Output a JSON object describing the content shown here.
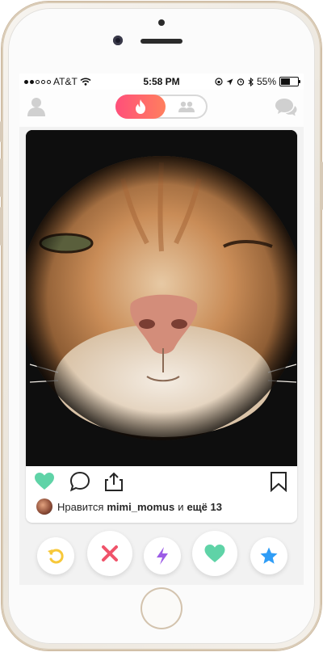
{
  "status_bar": {
    "carrier": "AT&T",
    "time": "5:58 PM",
    "battery_percent": "55%",
    "battery_level": 0.55,
    "signal_dots_filled": 2
  },
  "top_bar": {
    "left_icon": "profile-icon",
    "toggle": {
      "active": "flame-icon",
      "inactive": "group-icon"
    },
    "right_icon": "chat-icon"
  },
  "card": {
    "photo_subject": "",
    "actions": [
      "heart-icon",
      "comment-icon",
      "share-icon",
      "bookmark-icon"
    ],
    "liked_by": {
      "prefix": "Нравится",
      "user": "mimi_momus",
      "conj": "и",
      "others": "ещё 13"
    }
  },
  "bottom_actions": [
    "rewind-icon",
    "nope-icon",
    "boost-icon",
    "like-icon",
    "super-like-icon"
  ],
  "colors": {
    "accent_gradient_start": "#ff4f7a",
    "accent_gradient_end": "#ff7f5e",
    "like_green": "#5fd3a7",
    "nope_red": "#f0536a",
    "rewind_yellow": "#f7c83a",
    "boost_purple": "#9c5ce6",
    "super_blue": "#2f9df6"
  }
}
